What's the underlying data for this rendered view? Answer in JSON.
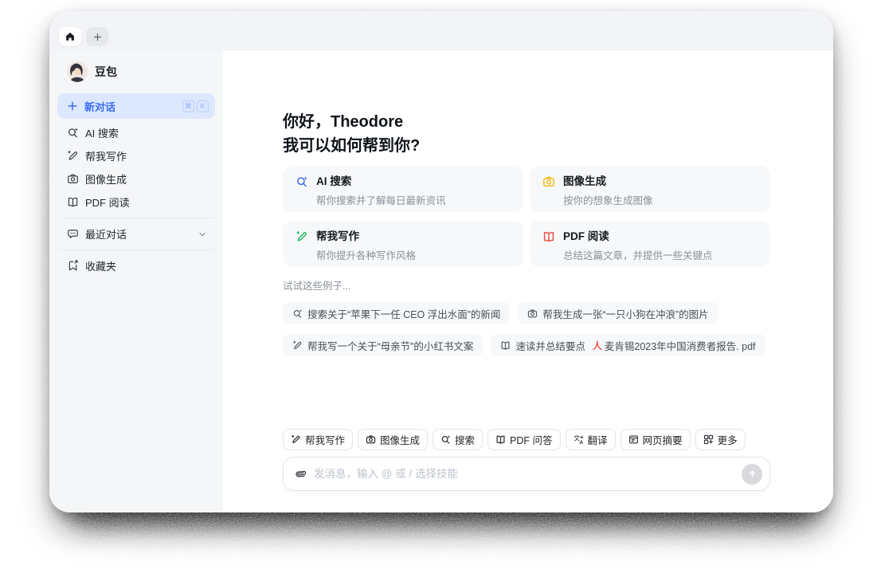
{
  "colors": {
    "accent_blue": "#3A6BF5",
    "green": "#23B858",
    "yellow": "#F6BB1E",
    "red": "#F0544C",
    "selected_item_bg": "#DCE8FE",
    "card_bg": "#F7F8FA",
    "send_button_bg": "#D8DADE"
  },
  "tabbar": {
    "home_tab_icon": "home",
    "new_tab_icon": "plus"
  },
  "sidebar": {
    "profile": {
      "name": "豆包",
      "avatar_icon": "female-avatar"
    },
    "new_chat": {
      "label": "新对话",
      "icon": "plus",
      "shortcut": [
        "⌘",
        "K"
      ]
    },
    "items": [
      {
        "label": "AI 搜索",
        "icon": "search-sparkle"
      },
      {
        "label": "帮我写作",
        "icon": "pen-sparkle"
      },
      {
        "label": "图像生成",
        "icon": "camera"
      },
      {
        "label": "PDF 阅读",
        "icon": "book"
      }
    ],
    "recent": {
      "label": "最近对话",
      "icon": "chat-bubble",
      "chevron_icon": "chevron-down"
    },
    "favorites": {
      "label": "收藏夹",
      "icon": "bookmark-arrow"
    }
  },
  "main": {
    "greeting": {
      "line1": "你好，Theodore",
      "line2": "我可以如何帮到你?"
    },
    "cards": [
      {
        "title": "AI 搜索",
        "desc": "帮你搜索并了解每日最新资讯",
        "icon": "search-sparkle",
        "icon_color": "#3A6BF5"
      },
      {
        "title": "图像生成",
        "desc": "按你的想象生成图像",
        "icon": "camera",
        "icon_color": "#F6BB1E"
      },
      {
        "title": "帮我写作",
        "desc": "帮你提升各种写作风格",
        "icon": "pen-sparkle",
        "icon_color": "#23B858"
      },
      {
        "title": "PDF 阅读",
        "desc": "总结这篇文章，并提供一些关键点",
        "icon": "book",
        "icon_color": "#F0544C"
      }
    ],
    "examples_label": "试试这些例子...",
    "examples": [
      {
        "text": "搜索关于“苹果下一任 CEO 浮出水面”的新闻",
        "icon": "search-sparkle"
      },
      {
        "text": "帮我生成一张“一只小狗在冲浪”的图片",
        "icon": "camera"
      },
      {
        "text": "帮我写一个关于“母亲节”的小红书文案",
        "icon": "pen-sparkle"
      },
      {
        "text": "速读并总结要点",
        "icon": "book",
        "attachment": "麦肯锡2023年中国消费者报告. pdf",
        "attachment_icon": "pdf-file"
      }
    ],
    "skills": [
      {
        "label": "帮我写作",
        "icon": "pen-sparkle"
      },
      {
        "label": "图像生成",
        "icon": "camera"
      },
      {
        "label": "搜索",
        "icon": "search-sparkle"
      },
      {
        "label": "PDF 问答",
        "icon": "book"
      },
      {
        "label": "翻译",
        "icon": "translate"
      },
      {
        "label": "网页摘要",
        "icon": "webpage"
      },
      {
        "label": "更多",
        "icon": "more-grid"
      }
    ],
    "composer": {
      "placeholder": "发消息，输入 @ 或 / 选择技能",
      "attach_icon": "paperclip",
      "send_icon": "arrow-up"
    }
  }
}
